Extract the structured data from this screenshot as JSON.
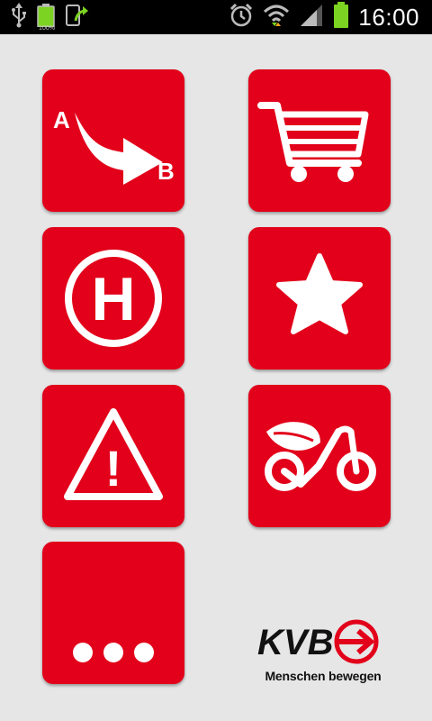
{
  "status_bar": {
    "time": "16:00",
    "battery_label": "100%",
    "icons": [
      "usb-icon",
      "battery-full-icon",
      "sync-icon",
      "alarm-icon",
      "wifi-icon",
      "signal-icon",
      "battery-icon"
    ],
    "battery_color": "#7dd321"
  },
  "tiles": [
    {
      "id": "route",
      "icon": "route-a-to-b-icon",
      "label_a": "A",
      "label_b": "B"
    },
    {
      "id": "shop",
      "icon": "shopping-cart-icon"
    },
    {
      "id": "stops",
      "icon": "bus-stop-h-icon",
      "label_h": "H"
    },
    {
      "id": "favorites",
      "icon": "star-icon"
    },
    {
      "id": "alerts",
      "icon": "warning-icon",
      "label_mark": "!"
    },
    {
      "id": "bike",
      "icon": "bike-sharing-icon"
    },
    {
      "id": "more",
      "icon": "more-dots-icon"
    }
  ],
  "logo": {
    "brand": "KVB",
    "tagline": "Menschen bewegen"
  },
  "colors": {
    "accent": "#e2001a",
    "background": "#e6e6e6",
    "statusbar": "#000000"
  }
}
